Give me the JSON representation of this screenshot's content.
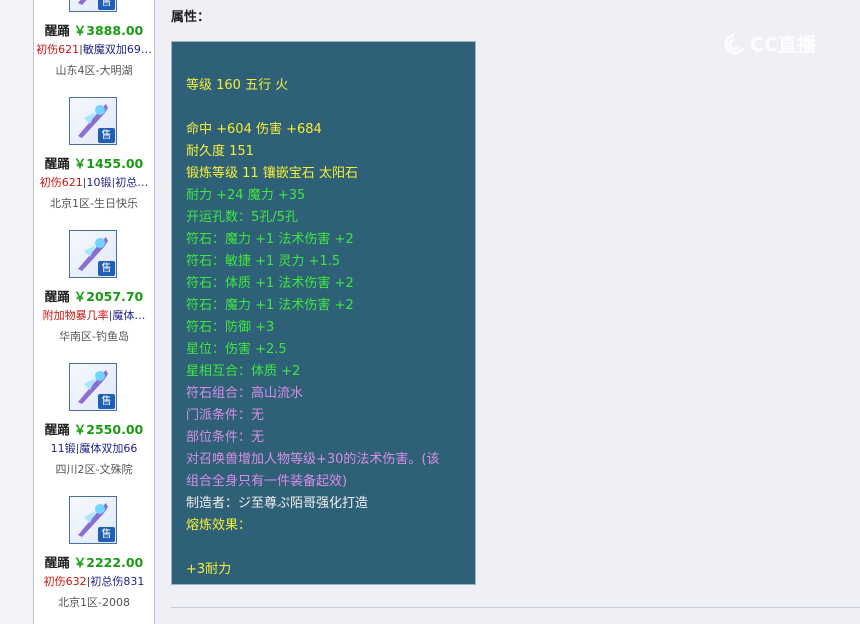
{
  "sidebar": {
    "items": [
      {
        "name": "醒踊",
        "price": "￥3888.00",
        "attr_left": "初伤621",
        "attr_right": "敏魔双加69…",
        "server": "山东4区-大明湖",
        "left_color": "red",
        "right_color": "blue"
      },
      {
        "name": "醒踊",
        "price": "￥1455.00",
        "attr_left": "初伤621",
        "attr_right": "10锻",
        "attr_extra": "初总…",
        "server": "北京1区-生日快乐",
        "left_color": "red",
        "right_color": "blue"
      },
      {
        "name": "醒踊",
        "price": "￥2057.70",
        "attr_left": "附加物暴几率",
        "attr_right": "魔体…",
        "server": "华南区-钓鱼岛",
        "left_color": "red",
        "right_color": "blue"
      },
      {
        "name": "醒踊",
        "price": "￥2550.00",
        "attr_left": "11锻",
        "attr_right": "魔体双加66",
        "server": "四川2区-文殊院",
        "left_color": "blue",
        "right_color": "blue"
      },
      {
        "name": "醒踊",
        "price": "￥2222.00",
        "attr_left": "初伤632",
        "attr_right": "初总伤831",
        "server": "北京1区-2008",
        "left_color": "red",
        "right_color": "blue"
      }
    ],
    "sale_label": "售"
  },
  "attributes": {
    "title": "属性：",
    "lines": [
      {
        "text": "等级 160 五行 火",
        "color": "yellow"
      },
      {
        "text": "命中 +604 伤害 +684",
        "color": "yellow"
      },
      {
        "text": "耐久度 151",
        "color": "yellow"
      },
      {
        "text": "锻炼等级 11 镶嵌宝石 太阳石",
        "color": "yellow"
      },
      {
        "text": "耐力 +24 魔力 +35",
        "color": "green"
      },
      {
        "text": "开运孔数：5孔/5孔",
        "color": "green"
      },
      {
        "text": "符石：魔力 +1 法术伤害 +2",
        "color": "green"
      },
      {
        "text": "符石：敏捷 +1 灵力 +1.5",
        "color": "green"
      },
      {
        "text": "符石：体质 +1 法术伤害 +2",
        "color": "green"
      },
      {
        "text": "符石：魔力 +1 法术伤害 +2",
        "color": "green"
      },
      {
        "text": "符石：防御 +3",
        "color": "green"
      },
      {
        "text": "星位：伤害 +2.5",
        "color": "green"
      },
      {
        "text": "星相互合：体质 +2",
        "color": "green"
      },
      {
        "text": "符石组合：高山流水",
        "color": "violet"
      },
      {
        "text": "门派条件：无",
        "color": "violet"
      },
      {
        "text": "部位条件：无",
        "color": "violet"
      },
      {
        "text": "对召唤兽增加人物等级+30的法术伤害。(该",
        "color": "violet"
      },
      {
        "text": "组合全身只有一件装备起效)",
        "color": "violet"
      },
      {
        "text": "制造者：ジ至尊ぷ陌哥强化打造",
        "color": "white"
      },
      {
        "text": "熔炼效果：",
        "color": "yellow"
      },
      {
        "text": "+3耐力",
        "color": "yellow"
      }
    ]
  },
  "watermark": {
    "text": "CC直播"
  },
  "colors": {
    "panel_bg": "#2e6078",
    "price_green": "#1a9b14",
    "attr_red": "#cc1111",
    "attr_blue": "#222288"
  }
}
